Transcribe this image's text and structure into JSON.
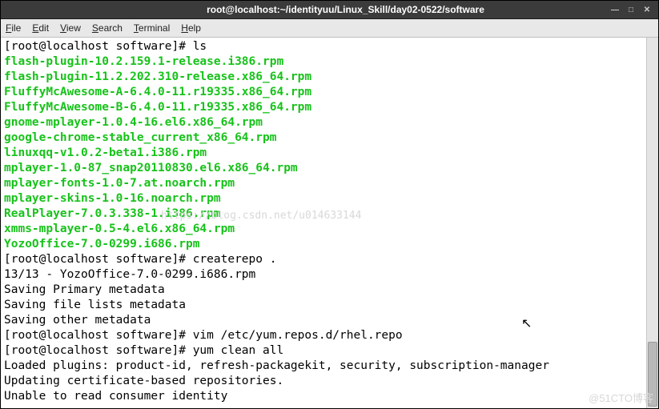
{
  "window": {
    "title": "root@localhost:~/identityuu/Linux_Skill/day02-0522/software"
  },
  "menu": {
    "file": "File",
    "edit": "Edit",
    "view": "View",
    "search": "Search",
    "terminal": "Terminal",
    "help": "Help"
  },
  "terminal": {
    "prompt": "[root@localhost software]# ",
    "cmd_ls": "ls",
    "files": [
      "flash-plugin-10.2.159.1-release.i386.rpm",
      "flash-plugin-11.2.202.310-release.x86_64.rpm",
      "FluffyMcAwesome-A-6.4.0-11.r19335.x86_64.rpm",
      "FluffyMcAwesome-B-6.4.0-11.r19335.x86_64.rpm",
      "gnome-mplayer-1.0.4-16.el6.x86_64.rpm",
      "google-chrome-stable_current_x86_64.rpm",
      "linuxqq-v1.0.2-beta1.i386.rpm",
      "mplayer-1.0-87_snap20110830.el6.x86_64.rpm",
      "mplayer-fonts-1.0-7.at.noarch.rpm",
      "mplayer-skins-1.0-16.noarch.rpm",
      "RealPlayer-7.0.3.338-1.i386.rpm",
      "xmms-mplayer-0.5-4.el6.x86_64.rpm",
      "YozoOffice-7.0-0299.i686.rpm"
    ],
    "cmd_createrepo": "createrepo .",
    "out1": "13/13 - YozoOffice-7.0-0299.i686.rpm",
    "out2": "Saving Primary metadata",
    "out3": "Saving file lists metadata",
    "out4": "Saving other metadata",
    "cmd_vim": "vim /etc/yum.repos.d/rhel.repo",
    "cmd_yum": "yum clean all",
    "out5": "Loaded plugins: product-id, refresh-packagekit, security, subscription-manager",
    "out6": "Updating certificate-based repositories.",
    "out7": "Unable to read consumer identity"
  },
  "watermark": {
    "csdn": "https://blog.csdn.net/u014633144",
    "cto": "@51CTO博客"
  }
}
